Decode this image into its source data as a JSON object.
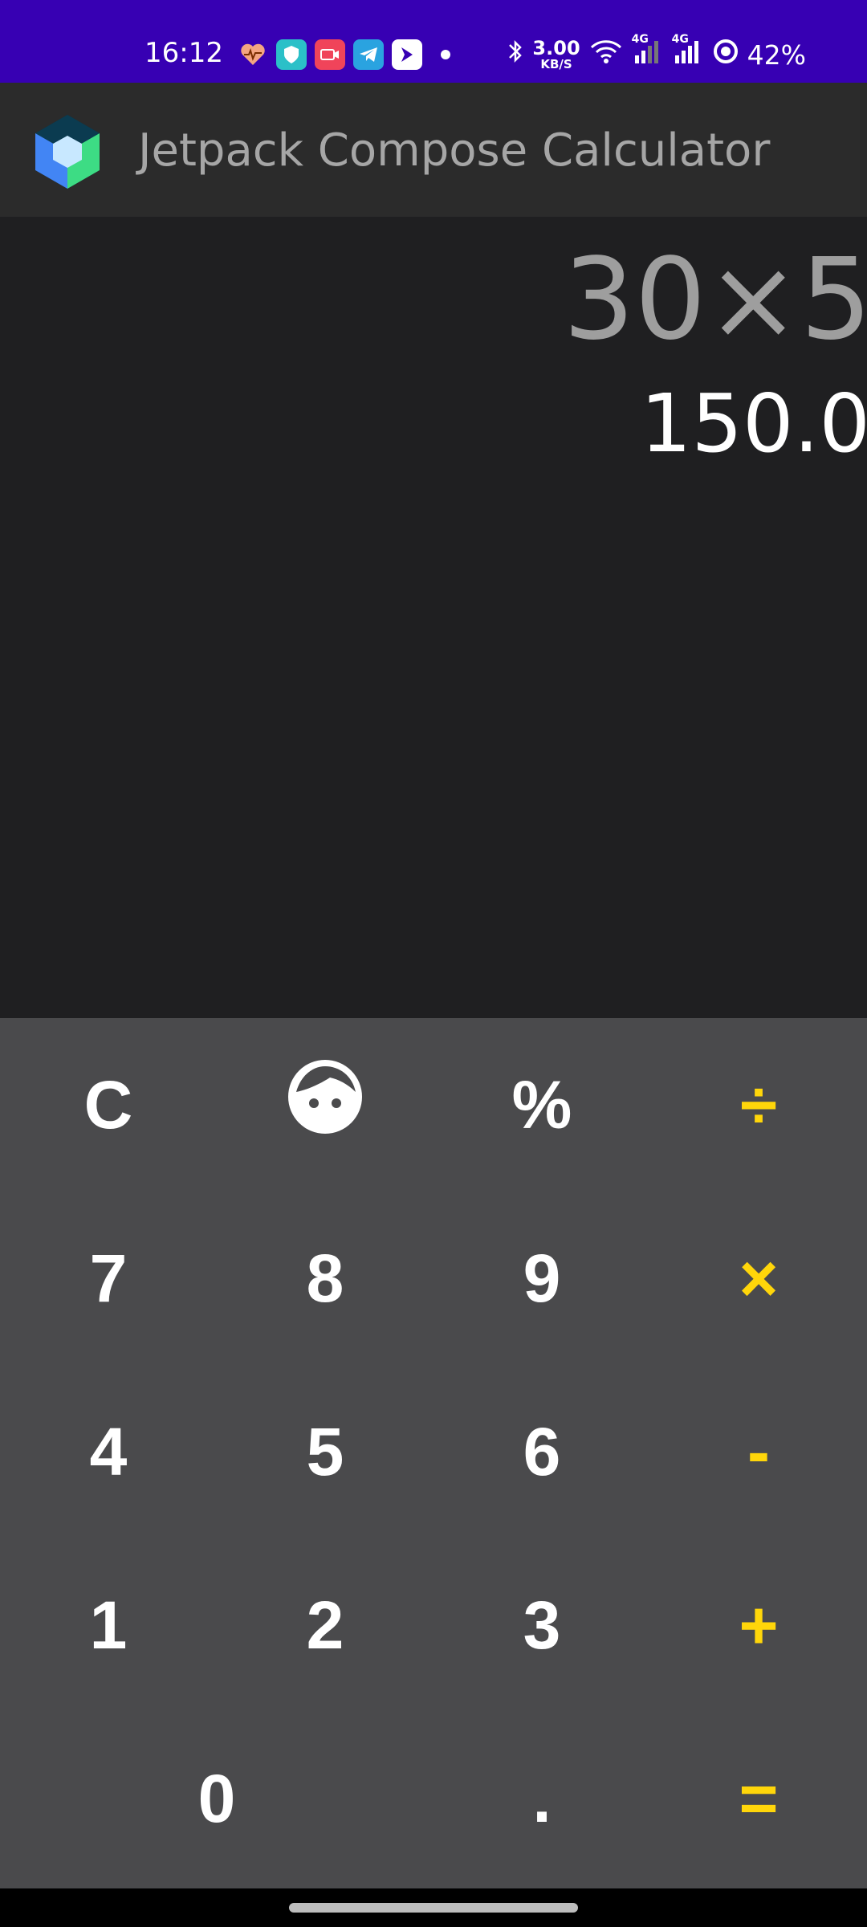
{
  "status_bar": {
    "time": "16:12",
    "notification_icons": [
      "heart-rate-icon",
      "shield-icon",
      "video-icon",
      "telegram-icon",
      "bird-icon",
      "dot-icon"
    ],
    "network_speed_value": "3.00",
    "network_speed_unit": "KB/S",
    "battery": "42%",
    "network_type": "4G",
    "colors": {
      "background": "#3700b3"
    }
  },
  "app_bar": {
    "title": "Jetpack Compose Calculator",
    "logo": "jetpack-compose-logo-icon",
    "colors": {
      "background": "#2b2b2b",
      "title": "#a6a6a6"
    }
  },
  "display": {
    "expression": "30×5",
    "result": "150.0",
    "colors": {
      "background": "#1f1f21",
      "expression": "#9e9e9e",
      "result": "#ffffff"
    }
  },
  "keypad": {
    "colors": {
      "background": "#4a4a4c",
      "digit": "#ffffff",
      "operator": "#ffd60a"
    },
    "keys": {
      "clear": "C",
      "face": "face-icon",
      "percent": "%",
      "divide": "÷",
      "seven": "7",
      "eight": "8",
      "nine": "9",
      "multiply": "×",
      "four": "4",
      "five": "5",
      "six": "6",
      "subtract": "-",
      "one": "1",
      "two": "2",
      "three": "3",
      "add": "+",
      "zero": "0",
      "decimal": ".",
      "equals": "="
    }
  }
}
